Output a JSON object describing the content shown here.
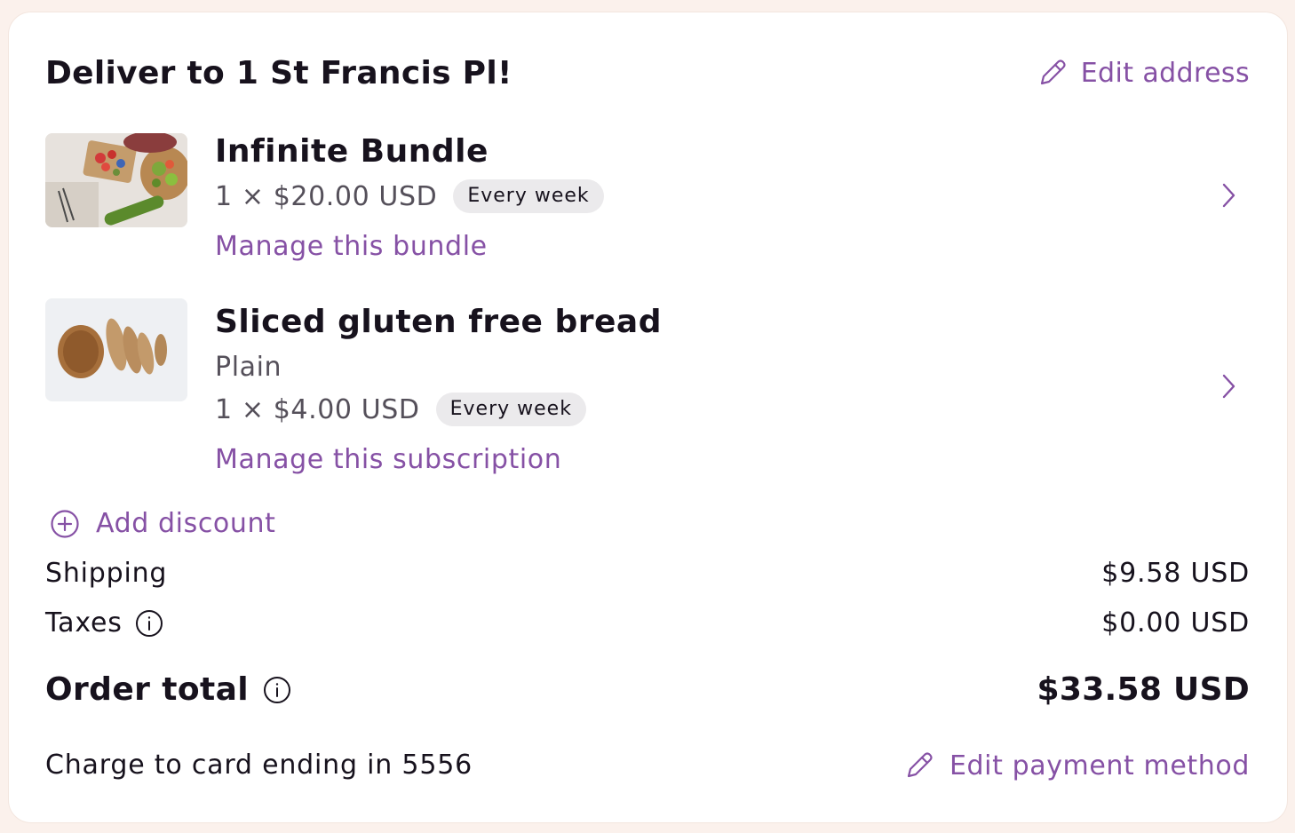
{
  "header": {
    "title": "Deliver to 1 St Francis Pl!",
    "edit_address_label": "Edit address"
  },
  "items": [
    {
      "name": "Infinite Bundle",
      "quantity_price": "1 × $20.00 USD",
      "frequency": "Every week",
      "manage_label": "Manage this bundle"
    },
    {
      "name": "Sliced gluten free bread",
      "variant": "Plain",
      "quantity_price": "1 × $4.00 USD",
      "frequency": "Every week",
      "manage_label": "Manage this subscription"
    }
  ],
  "discount": {
    "label": "Add discount"
  },
  "summary": {
    "shipping_label": "Shipping",
    "shipping_value": "$9.58 USD",
    "taxes_label": "Taxes",
    "taxes_value": "$0.00 USD",
    "total_label": "Order total",
    "total_value": "$33.58 USD"
  },
  "payment": {
    "charge_text": "Charge to card ending in 5556",
    "edit_label": "Edit payment method"
  },
  "icons": {
    "edit": "pencil-icon",
    "chevron": "chevron-right-icon",
    "add": "plus-circle-icon",
    "info": "info-icon"
  },
  "colors": {
    "accent": "#8651a5",
    "text": "#17121d",
    "muted": "#55505a",
    "pill_bg": "#ebeaec",
    "page_bg": "#fbf1ec",
    "card_bg": "#ffffff"
  }
}
